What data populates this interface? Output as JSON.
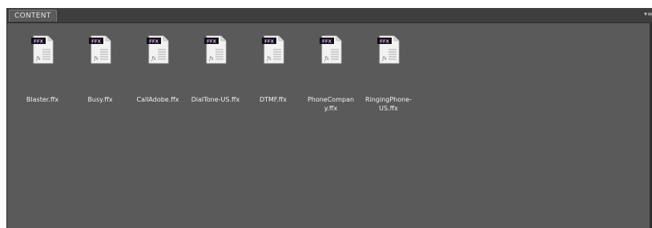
{
  "panel": {
    "tab_label": "CONTENT",
    "menu_icon": "panel-menu-icon"
  },
  "files": [
    {
      "name": "Blaster.ffx",
      "badge": "FFX",
      "glyph": "fx",
      "icon": "ffx-file-icon"
    },
    {
      "name": "Busy.ffx",
      "badge": "FFX",
      "glyph": "fx",
      "icon": "ffx-file-icon"
    },
    {
      "name": "CallAdobe.ffx",
      "badge": "FFX",
      "glyph": "fx",
      "icon": "ffx-file-icon"
    },
    {
      "name": "DialTone-US.ffx",
      "badge": "FFX",
      "glyph": "fx",
      "icon": "ffx-file-icon"
    },
    {
      "name": "DTMF.ffx",
      "badge": "FFX",
      "glyph": "fx",
      "icon": "ffx-file-icon"
    },
    {
      "name": "PhoneCompany.ffx",
      "display_lines": [
        "PhoneCompan",
        "y.ffx"
      ],
      "badge": "FFX",
      "glyph": "fx",
      "icon": "ffx-file-icon"
    },
    {
      "name": "RingingPhone-US.ffx",
      "display_lines": [
        "RingingPhone-",
        "US.ffx"
      ],
      "badge": "FFX",
      "glyph": "fx",
      "icon": "ffx-file-icon"
    }
  ],
  "colors": {
    "panel_bg": "#5a5a5a",
    "tabbar_bg": "#3e3e3e",
    "badge_bg": "#111111",
    "badge_text": "#d9a8ff",
    "file_text": "#f0f0f0"
  }
}
